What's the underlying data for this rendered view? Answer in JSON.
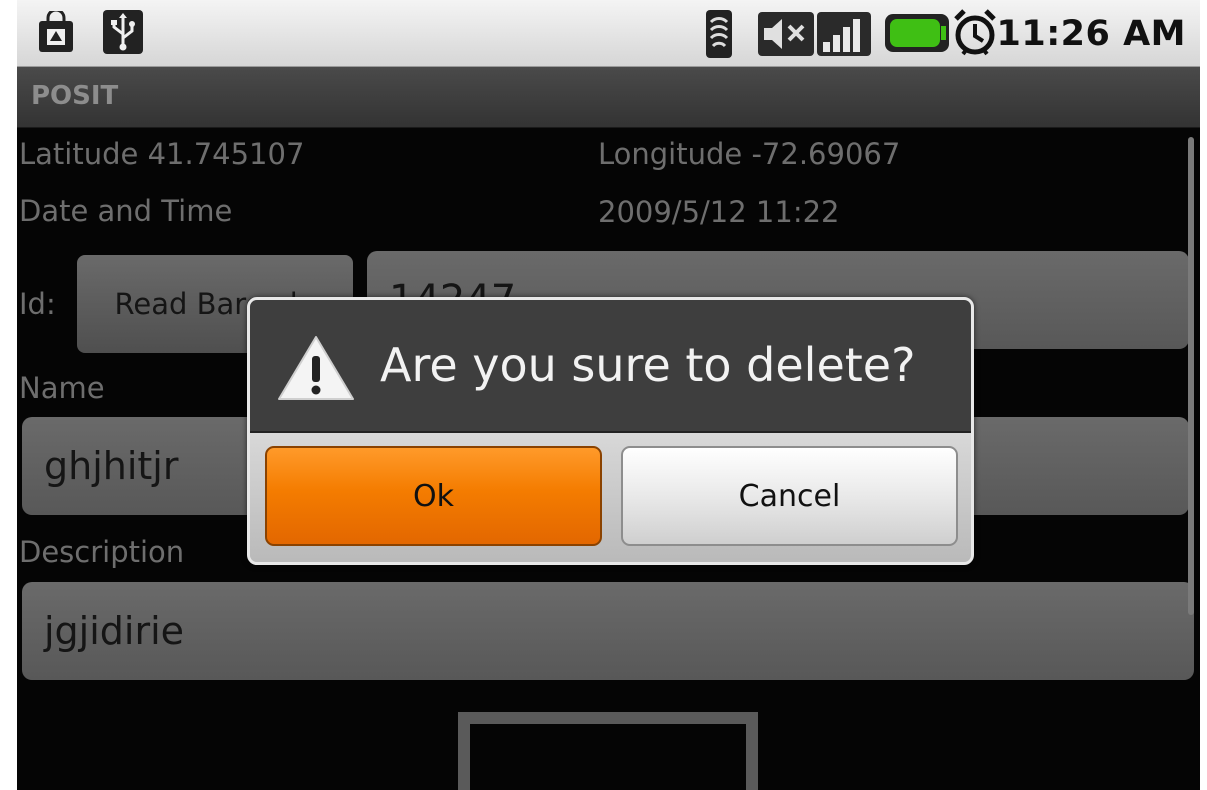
{
  "status_bar": {
    "time": "11:26 AM",
    "icons": [
      "shopping-bag-icon",
      "usb-icon",
      "wifi-icon",
      "volume-muted-icon",
      "signal-icon",
      "battery-icon",
      "alarm-icon"
    ],
    "battery_color": "#3fbf14"
  },
  "app": {
    "title": "POSIT"
  },
  "form": {
    "latitude_label": "Latitude 41.745107",
    "longitude_label": "Longitude  -72.69067",
    "datetime_label": "Date and Time",
    "datetime_value": "2009/5/12 11:22",
    "id_label": "Id:",
    "read_barcode_label": "Read Barcode",
    "id_value": "14247",
    "name_label": "Name",
    "name_value": "ghjhitjr",
    "description_label": "Description",
    "description_value": "jgjidirie"
  },
  "dialog": {
    "title": "Are you sure to delete?",
    "ok_label": "Ok",
    "cancel_label": "Cancel",
    "ok_color": "#f47c00"
  }
}
